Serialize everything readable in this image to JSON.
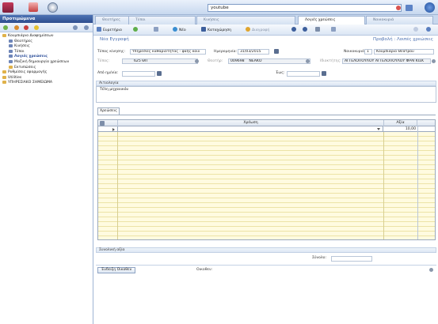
{
  "topbar": {
    "search_value": "youtube"
  },
  "sidebar": {
    "title": "Προτιμώμενα",
    "items": [
      {
        "label": "Κουμπιάριο Διαφημίσεων",
        "color": "#e0b24a"
      },
      {
        "label": "Θεατήρες",
        "color": "#6f86b8"
      },
      {
        "label": "Κινήσεις",
        "color": "#6f86b8"
      },
      {
        "label": "Τύποι",
        "color": "#6f86b8"
      },
      {
        "label": "Λογιές χρεώσεις",
        "color": "#6f86b8",
        "active": true
      },
      {
        "label": "Μαζική δημιουργία χρεώσεων",
        "color": "#6f86b8"
      },
      {
        "label": "Εκτυπώσεις",
        "color": "#e0b24a"
      },
      {
        "label": "Ρυθμίσεις εφαρμογής",
        "color": "#e0b24a"
      },
      {
        "label": "Utilities",
        "color": "#e0b24a"
      },
      {
        "label": "ΥΠΗΡΕΣΙΑΚΟ ΣΗΜΕΙΩΜΑ",
        "color": "#e0b24a"
      }
    ]
  },
  "tabs": [
    {
      "label": "Θεατήρες",
      "active": false
    },
    {
      "label": "Τύποι",
      "active": false
    },
    {
      "label": "Κινήσεις",
      "active": false
    },
    {
      "label": "Λογιές χρεώσεις",
      "active": true
    },
    {
      "label": "Νοικοκυριά",
      "active": false
    }
  ],
  "toolbar": {
    "register": "Ευρετήριο",
    "new": "Νέο",
    "save": "Καταχώρηση",
    "delete": "Διαγραφή"
  },
  "form": {
    "heading": "Νέα Εγγραφή",
    "breadcrumb": "Προβολή : Λοιπές χρεώσεις",
    "movement_type_label": "Τύπος κίνησης:",
    "movement_type_value": "Υπηρεσίες καθαριότητας - φαής κοιν",
    "date_label": "Ημερομηνία:",
    "date_value": "31/03/2015",
    "household_label": "Νοικοκυριό:",
    "household_num": "1",
    "household_value": "Κουμπιάριο Θεάτρου",
    "type_label": "Τύπος:",
    "type_code": "625",
    "type_value": "ΘΠ",
    "viewer_label": "Θεατήρ:",
    "viewer_code": "009698",
    "viewer_value": "ΝΕΑΚΟ",
    "owner_label": "Ιδιοκτήτης:",
    "owner_value": "ΑΓΓΕΛΟΠΟΥΛΟΥ ΑΓΓΕΛΟΠΟΥΛΟΥ ΦΡΑΓΚΙΣΚ",
    "from_label": "Από ημ/νία:",
    "to_label": "Έως:",
    "reason_section": "Αιτιολογία",
    "reason_value": "Τέλη μηχανικόυ",
    "charges_tab": "Χρεώσεις",
    "col_description": "Χρέωση",
    "col_value": "Αξία",
    "row_value": "10,00",
    "total_section": "Συνολική αξία",
    "total_label": "Σύνολο:",
    "owners_button": "Ένδειξη Οικοθεν",
    "owners_label": "Οικοθεν:"
  }
}
